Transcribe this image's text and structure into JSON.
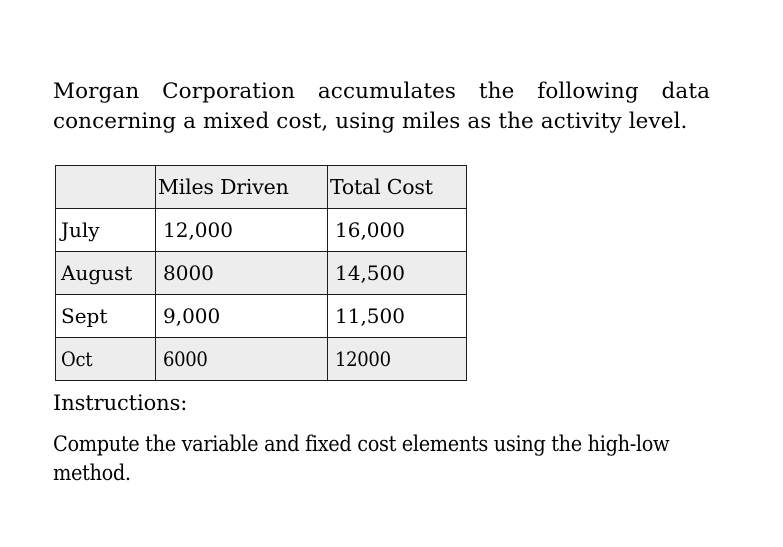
{
  "document": {
    "intro_paragraph": "Morgan Corporation accumulates the following data concerning a mixed cost, using miles as the activity level.",
    "instructions_label": "Instructions:",
    "instructions_body": "Compute the variable and fixed cost elements using the high-low method."
  },
  "table": {
    "headers": {
      "corner": "",
      "miles_driven": "Miles Driven",
      "total_cost": "Total Cost"
    },
    "rows": [
      {
        "month": "July",
        "miles_driven": "12,000",
        "total_cost": "16,000"
      },
      {
        "month": "August",
        "miles_driven": "8000",
        "total_cost": "14,500"
      },
      {
        "month": "Sept",
        "miles_driven": "9,000",
        "total_cost": "11,500"
      },
      {
        "month": "Oct",
        "miles_driven": "6000",
        "total_cost": "12000"
      }
    ]
  },
  "style": {
    "page_background": "#ffffff",
    "shaded_row_background": "#ededed",
    "header_background": "#ededed",
    "border_color": "#1c1c1c",
    "text_color": "#000000"
  }
}
